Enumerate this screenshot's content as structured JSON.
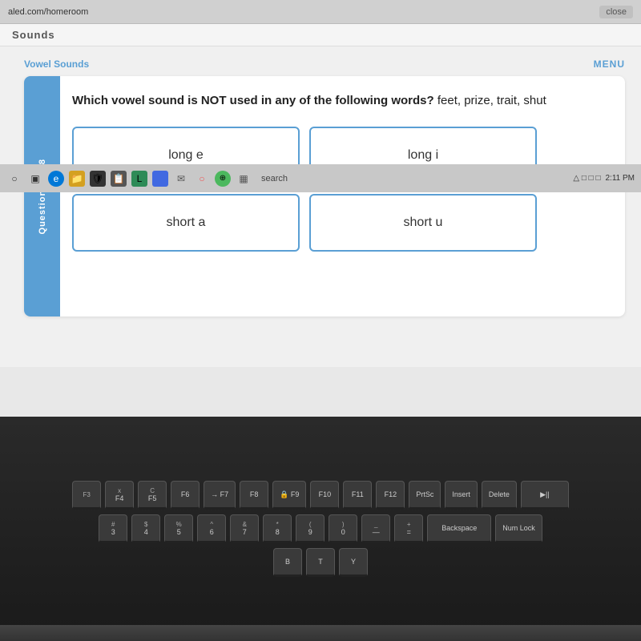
{
  "browser": {
    "url": "aled.com/homeroom",
    "close_label": "close"
  },
  "page": {
    "header": "Sounds",
    "menu_label": "MENU",
    "section_label": "Vowel Sounds",
    "side_label": "Question 3 of 8"
  },
  "question": {
    "prompt_bold": "Which vowel sound is NOT used in any of the following words?",
    "prompt_plain": " feet, prize, trait, shut"
  },
  "answers": [
    {
      "id": "long-e",
      "label": "long e"
    },
    {
      "id": "long-i",
      "label": "long  i"
    },
    {
      "id": "short-a",
      "label": "short a"
    },
    {
      "id": "short-u",
      "label": "short u"
    }
  ],
  "taskbar": {
    "search_placeholder": "search"
  },
  "colors": {
    "accent": "#5a9fd4",
    "border": "#5a9fd4",
    "bg": "#f0f0f0"
  }
}
